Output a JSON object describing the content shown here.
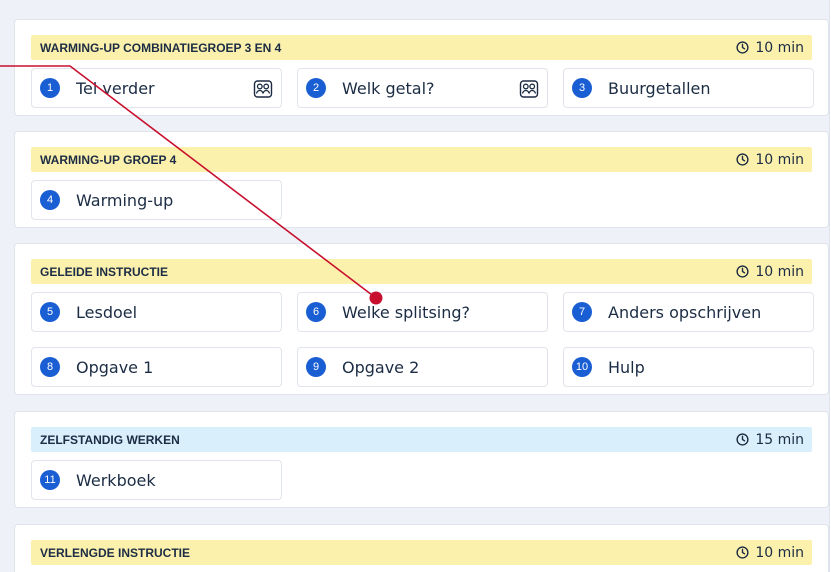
{
  "sections": [
    {
      "title": "WARMING-UP COMBINATIEGROEP 3 EN 4",
      "time": "10 min",
      "color": "yellow",
      "cards": [
        {
          "num": "1",
          "label": "Tel verder",
          "group_icon": true
        },
        {
          "num": "2",
          "label": "Welk getal?",
          "group_icon": true
        },
        {
          "num": "3",
          "label": "Buurgetallen",
          "group_icon": false
        }
      ]
    },
    {
      "title": "WARMING-UP GROEP 4",
      "time": "10 min",
      "color": "yellow",
      "cards": [
        {
          "num": "4",
          "label": "Warming-up"
        }
      ]
    },
    {
      "title": "GELEIDE INSTRUCTIE",
      "time": "10 min",
      "color": "yellow",
      "cards": [
        {
          "num": "5",
          "label": "Lesdoel"
        },
        {
          "num": "6",
          "label": "Welke splitsing?"
        },
        {
          "num": "7",
          "label": "Anders opschrijven"
        },
        {
          "num": "8",
          "label": "Opgave 1"
        },
        {
          "num": "9",
          "label": "Opgave 2"
        },
        {
          "num": "10",
          "label": "Hulp"
        }
      ]
    },
    {
      "title": "ZELFSTANDIG WERKEN",
      "time": "15 min",
      "color": "blue",
      "cards": [
        {
          "num": "11",
          "label": "Werkboek"
        }
      ]
    },
    {
      "title": "VERLENGDE INSTRUCTIE",
      "time": "10 min",
      "color": "yellow",
      "cards": []
    }
  ],
  "icons": {
    "time": "clock-icon",
    "group": "group-work-icon"
  },
  "colors": {
    "badge": "#1a5ed4",
    "header_yellow": "#fcf1ac",
    "header_blue": "#d9effb",
    "annotation": "#c8102e"
  }
}
